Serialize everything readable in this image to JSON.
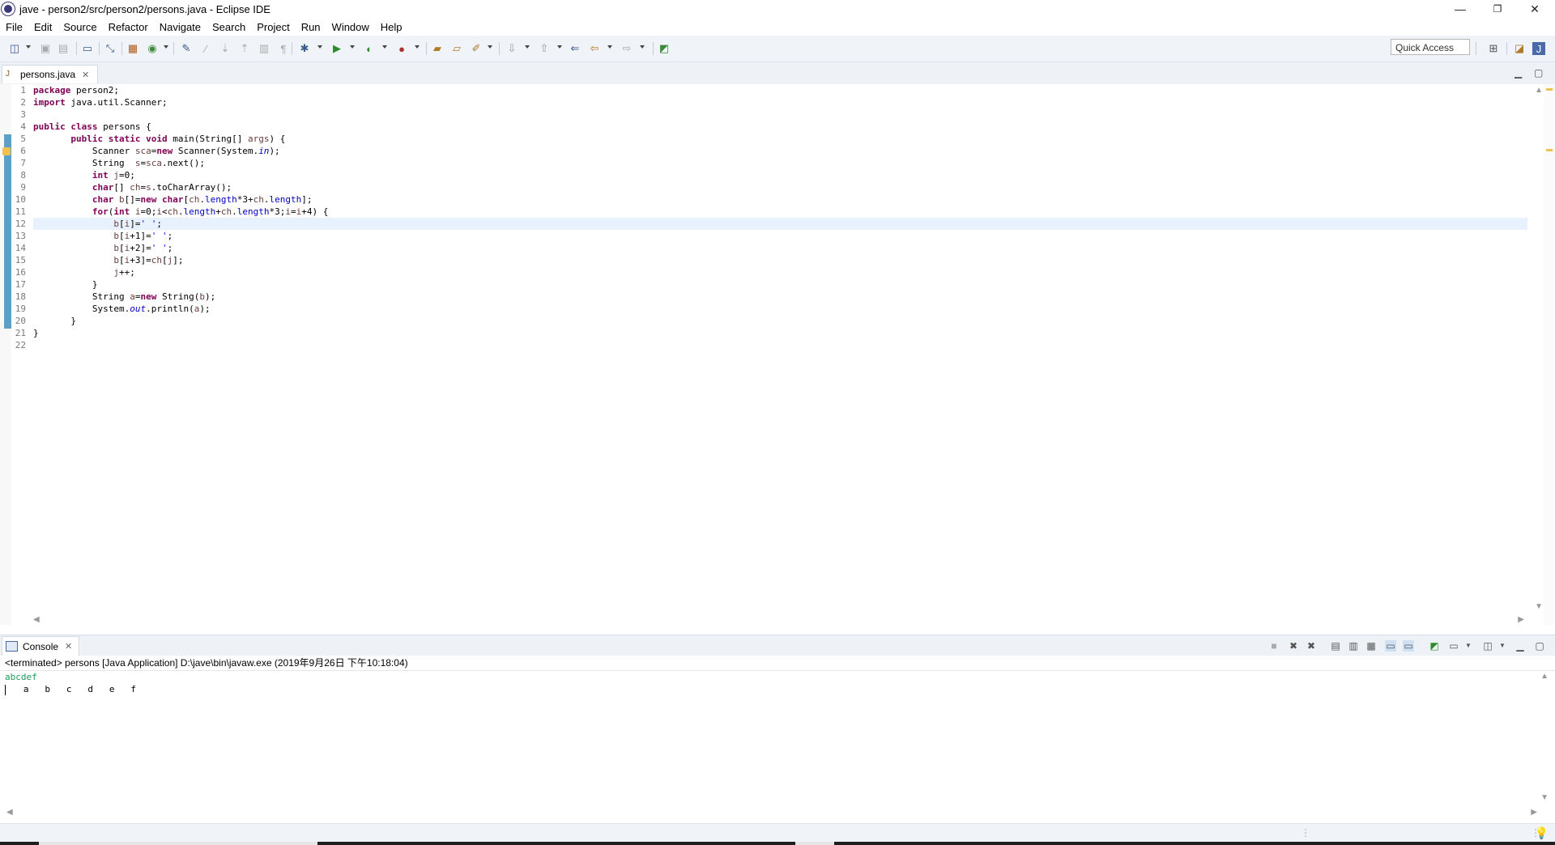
{
  "window": {
    "title": "jave - person2/src/person2/persons.java - Eclipse IDE",
    "controls": [
      "—",
      "❐",
      "✕"
    ]
  },
  "menu": [
    "File",
    "Edit",
    "Source",
    "Refactor",
    "Navigate",
    "Search",
    "Project",
    "Run",
    "Window",
    "Help"
  ],
  "toolbar": {
    "quick_access_placeholder": "Quick Access"
  },
  "editor": {
    "tab_label": "persons.java",
    "current_line": 12,
    "line_numbers": [
      "1",
      "2",
      "3",
      "4",
      "5",
      "6",
      "7",
      "8",
      "9",
      "10",
      "11",
      "12",
      "13",
      "14",
      "15",
      "16",
      "17",
      "18",
      "19",
      "20",
      "21",
      "22"
    ],
    "lines": [
      "package person2;",
      "import java.util.Scanner;",
      "",
      "public class persons {",
      "       public static void main(String[] args) {",
      "           Scanner sca=new Scanner(System.in);",
      "           String  s=sca.next();",
      "           int j=0;",
      "           char[] ch=s.toCharArray();",
      "           char b[]=new char[ch.length*3+ch.length];",
      "           for(int i=0;i<ch.length+ch.length*3;i=i+4) {",
      "               b[i]=' ';",
      "               b[i+1]=' ';",
      "               b[i+2]=' ';",
      "               b[i+3]=ch[j];",
      "               j++;",
      "           }",
      "           String a=new String(b);",
      "           System.out.println(a);",
      "       }",
      "}",
      ""
    ]
  },
  "console": {
    "tab_label": "Console",
    "status": "<terminated> persons [Java Application] D:\\jave\\bin\\javaw.exe (2019年9月26日 下午10:18:04)",
    "input_line": "abcdef",
    "output_line": "   a   b   c   d   e   f"
  },
  "colors": {
    "keyword": "#7f0055",
    "string": "#2a00ff",
    "field": "#0000c0",
    "local_var": "#6a3e3e",
    "stdin": "#1f9c5a",
    "change_bar": "#5e9fc5"
  }
}
